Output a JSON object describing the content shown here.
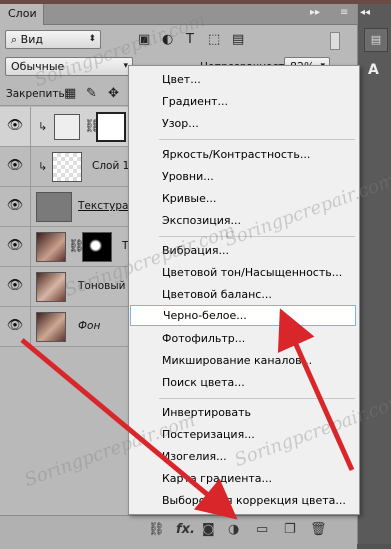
{
  "panel": {
    "tab": "Слои",
    "tab_controls": "▸▸ ≡"
  },
  "filter": {
    "value": "Вид"
  },
  "blend": {
    "mode": "Обычные",
    "opacity_label": "Непрозрачность:",
    "opacity_value": "82%"
  },
  "lock": {
    "label": "Закрепить:"
  },
  "layers": [
    {
      "name": ""
    },
    {
      "name": "Слой 1"
    },
    {
      "name": "Текстура"
    },
    {
      "name": "T"
    },
    {
      "name": "Тоновый р"
    },
    {
      "name": "Фон"
    }
  ],
  "menu": {
    "items": [
      "Цвет...",
      "Градиент...",
      "Узор...",
      "Яркость/Контрастность...",
      "Уровни...",
      "Кривые...",
      "Экспозиция...",
      "Вибрация...",
      "Цветовой тон/Насыщенность...",
      "Цветовой баланс...",
      "Черно-белое...",
      "Фотофильтр...",
      "Микширование каналов...",
      "Поиск цвета...",
      "Инвертировать",
      "Постеризация...",
      "Изогелия...",
      "Карта градиента...",
      "Выборочная коррекция цвета..."
    ]
  },
  "watermark": "Soringpcrepair.com",
  "colors": {
    "arrow": "#d9262b",
    "highlight_border": "#7eb4ea"
  }
}
